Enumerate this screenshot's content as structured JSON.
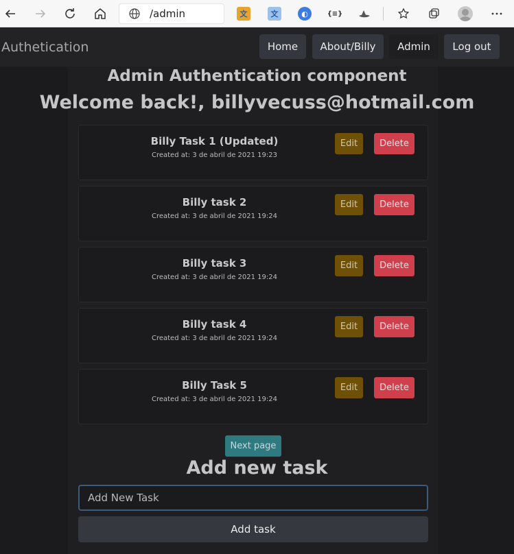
{
  "browser": {
    "url": "/admin",
    "icons": [
      "back-icon",
      "forward-icon",
      "refresh-icon",
      "home-icon",
      "globe-icon",
      "translate-extension-icon",
      "translate-extension-2-icon",
      "circle-extension-icon",
      "code-extension-icon",
      "hat-extension-icon",
      "favorites-icon",
      "collections-icon",
      "profile-icon",
      "more-icon"
    ],
    "ext_code_label": "{≡}"
  },
  "navbar": {
    "brand": "Authetication",
    "home": "Home",
    "about": "About/Billy",
    "admin": "Admin",
    "logout": "Log out"
  },
  "header": {
    "title": "Admin Authentication component",
    "welcome": "Welcome back!, billyvecuss@hotmail.com"
  },
  "tasks": [
    {
      "title": "Billy Task 1 (Updated)",
      "created": "Created at: 3 de abril de 2021 19:23",
      "edit": "Edit",
      "delete": "Delete"
    },
    {
      "title": "Billy task 2",
      "created": "Created at: 3 de abril de 2021 19:24",
      "edit": "Edit",
      "delete": "Delete"
    },
    {
      "title": "Billy task 3",
      "created": "Created at: 3 de abril de 2021 19:24",
      "edit": "Edit",
      "delete": "Delete"
    },
    {
      "title": "Billy task 4",
      "created": "Created at: 3 de abril de 2021 19:24",
      "edit": "Edit",
      "delete": "Delete"
    },
    {
      "title": "Billy Task 5",
      "created": "Created at: 3 de abril de 2021 19:24",
      "edit": "Edit",
      "delete": "Delete"
    }
  ],
  "pagination": {
    "next": "Next page"
  },
  "add_form": {
    "heading": "Add new task",
    "placeholder": "Add New Task",
    "button": "Add task"
  },
  "colors": {
    "edit": "#6e5106",
    "delete": "#cf3f4c",
    "next": "#2f7a81",
    "background": "#1b1b1d"
  }
}
